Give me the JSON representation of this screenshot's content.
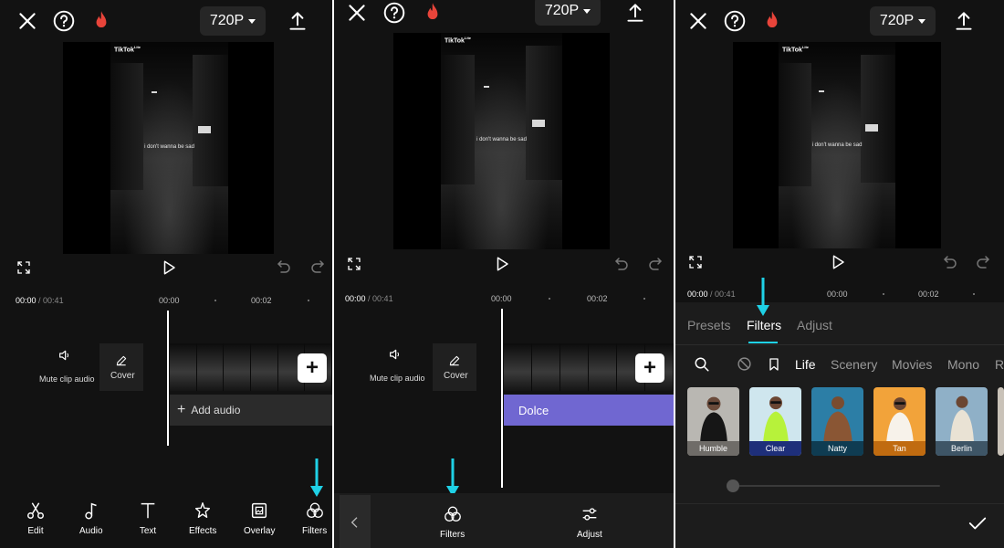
{
  "resolution": "720P",
  "current_time": "00:00",
  "total_time": "/ 00:41",
  "ticks": [
    "00:00",
    "00:02"
  ],
  "watermark": {
    "brand": "TikTok",
    "lite": "Lite"
  },
  "lyric": "i don't wanna be sad",
  "timeline": {
    "mute_label": "Mute clip audio",
    "cover_label": "Cover",
    "add_audio_label": "Add audio",
    "filter_track_label": "Dolce"
  },
  "main_toolbar": [
    {
      "label": "Edit",
      "icon": "scissors-icon"
    },
    {
      "label": "Audio",
      "icon": "music-note-icon"
    },
    {
      "label": "Text",
      "icon": "text-icon"
    },
    {
      "label": "Effects",
      "icon": "effects-star-icon"
    },
    {
      "label": "Overlay",
      "icon": "overlay-icon"
    },
    {
      "label": "Filters",
      "icon": "filters-icon"
    }
  ],
  "filter_toolbar": [
    {
      "label": "Filters",
      "icon": "filters-icon"
    },
    {
      "label": "Adjust",
      "icon": "adjust-sliders-icon"
    }
  ],
  "filter_panel": {
    "tabs": [
      "Presets",
      "Filters",
      "Adjust"
    ],
    "active_tab": "Filters",
    "categories": [
      "Life",
      "Scenery",
      "Movies",
      "Mono",
      "R"
    ],
    "active_category": "Life",
    "filters": [
      {
        "name": "Humble",
        "bg": "#b9b7b2",
        "label_bg": "#6f6c68"
      },
      {
        "name": "Clear",
        "bg": "#cfe6ee",
        "label_bg": "#1e2f7a"
      },
      {
        "name": "Natty",
        "bg": "#2c7ea6",
        "label_bg": "#0f3c52"
      },
      {
        "name": "Tan",
        "bg": "#f2a33a",
        "label_bg": "#c06b10"
      },
      {
        "name": "Berlin",
        "bg": "#8fb0c7",
        "label_bg": "#3e5566"
      }
    ]
  },
  "colors": {
    "accent": "#1fd1e6",
    "filter_track": "#7067d1",
    "fire": "#e8443a"
  }
}
